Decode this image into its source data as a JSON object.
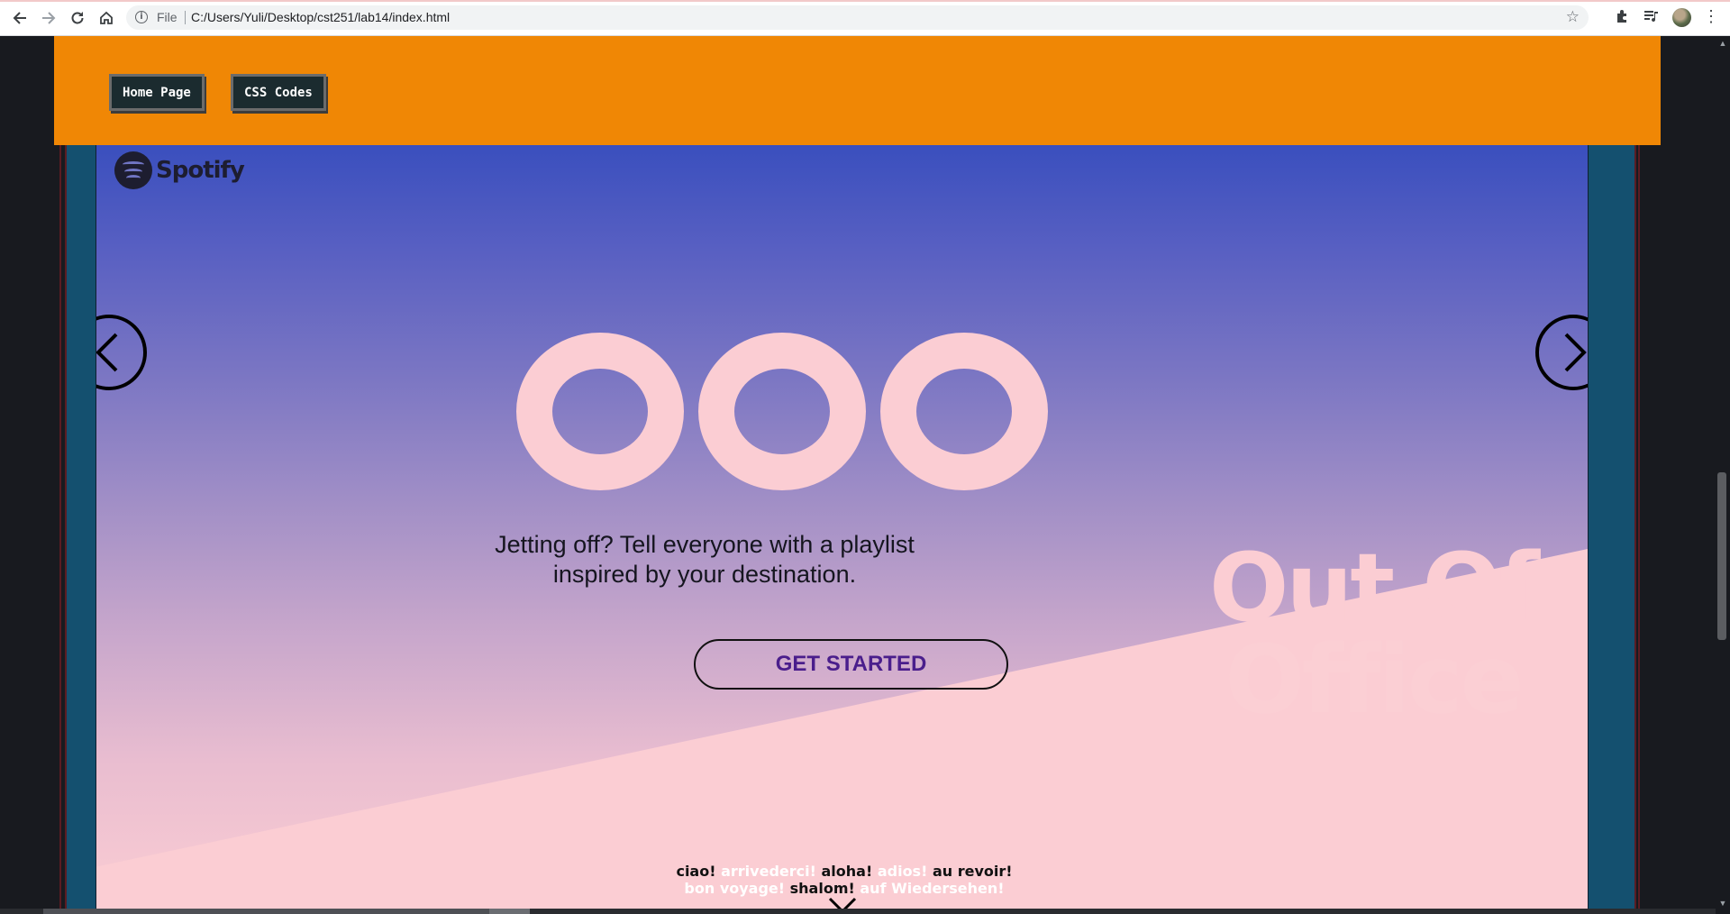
{
  "browser": {
    "scheme_label": "File",
    "url": "C:/Users/Yuli/Desktop/cst251/lab14/index.html",
    "icons": [
      "back-icon",
      "forward-icon",
      "reload-icon",
      "home-icon",
      "info-icon",
      "star-icon",
      "extensions-icon",
      "media-icon",
      "profile-avatar",
      "menu-icon"
    ]
  },
  "header": {
    "background": "#f08705",
    "buttons": [
      {
        "label": "Home Page"
      },
      {
        "label": "CSS Codes"
      }
    ]
  },
  "hero": {
    "brand": "Spotify",
    "headline_line1": "Jetting off? Tell everyone with a playlist",
    "headline_line2": "inspired by your destination.",
    "cta_label": "GET STARTED",
    "big_title_line1": "Out Of",
    "big_title_line2": "Office",
    "colors": {
      "pink": "#fbcdd3",
      "blue": "#3a4fbe",
      "cta_text": "#4a1e8c"
    }
  },
  "greetings": {
    "line1": [
      {
        "text": "ciao!",
        "tone": "dark"
      },
      {
        "text": "arrivederci!",
        "tone": "light"
      },
      {
        "text": "aloha!",
        "tone": "dark"
      },
      {
        "text": "adios!",
        "tone": "light"
      },
      {
        "text": "au revoir!",
        "tone": "dark"
      }
    ],
    "line2": [
      {
        "text": "bon voyage!",
        "tone": "light"
      },
      {
        "text": "shalom!",
        "tone": "dark"
      },
      {
        "text": "auf Wiedersehen!",
        "tone": "light"
      }
    ]
  }
}
